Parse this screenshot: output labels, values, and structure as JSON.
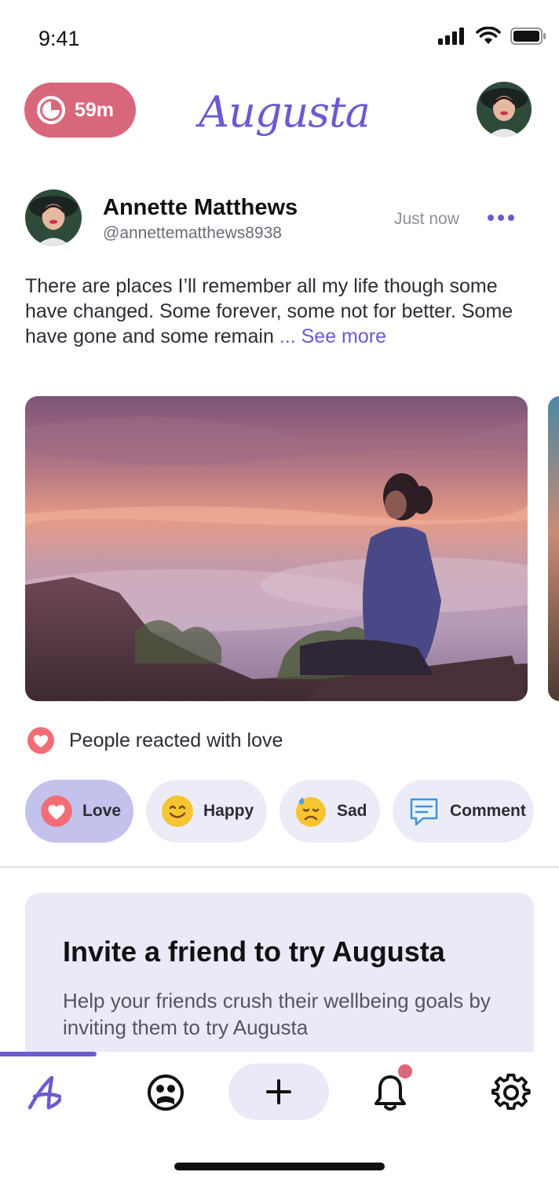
{
  "status_bar": {
    "time": "9:41",
    "icons": [
      "cellular-signal-icon",
      "wifi-icon",
      "battery-icon"
    ]
  },
  "header": {
    "timer_label": "59m",
    "timer_icon": "timer-ring-icon",
    "logo_text": "Augusta",
    "colors": {
      "timer_pill": "#d9677c",
      "brand": "#6a5bd0"
    }
  },
  "post": {
    "author": "Annette Matthews",
    "handle": "@annettematthews8938",
    "time": "Just now",
    "text": "There are places I’ll remember all my life though some have changed. Some forever, some not for better. Some have gone and some remain ",
    "see_more": "... See more",
    "reaction_summary": "People reacted with love",
    "reactions": [
      {
        "label": "Love",
        "icon": "heart-icon",
        "active": true
      },
      {
        "label": "Happy",
        "icon": "smile-emoji-icon",
        "active": false
      },
      {
        "label": "Sad",
        "icon": "sad-emoji-icon",
        "active": false
      },
      {
        "label": "Comment",
        "icon": "comment-icon",
        "active": false
      }
    ]
  },
  "invite": {
    "title": "Invite a friend to try Augusta",
    "body": "Help your friends crush their wellbeing goals by inviting them to try Augusta"
  },
  "bottom_nav": {
    "items": [
      "home-logo-icon",
      "mood-face-icon",
      "add-icon",
      "bell-icon",
      "gear-icon"
    ],
    "active": "home-logo-icon",
    "has_notification": true
  }
}
